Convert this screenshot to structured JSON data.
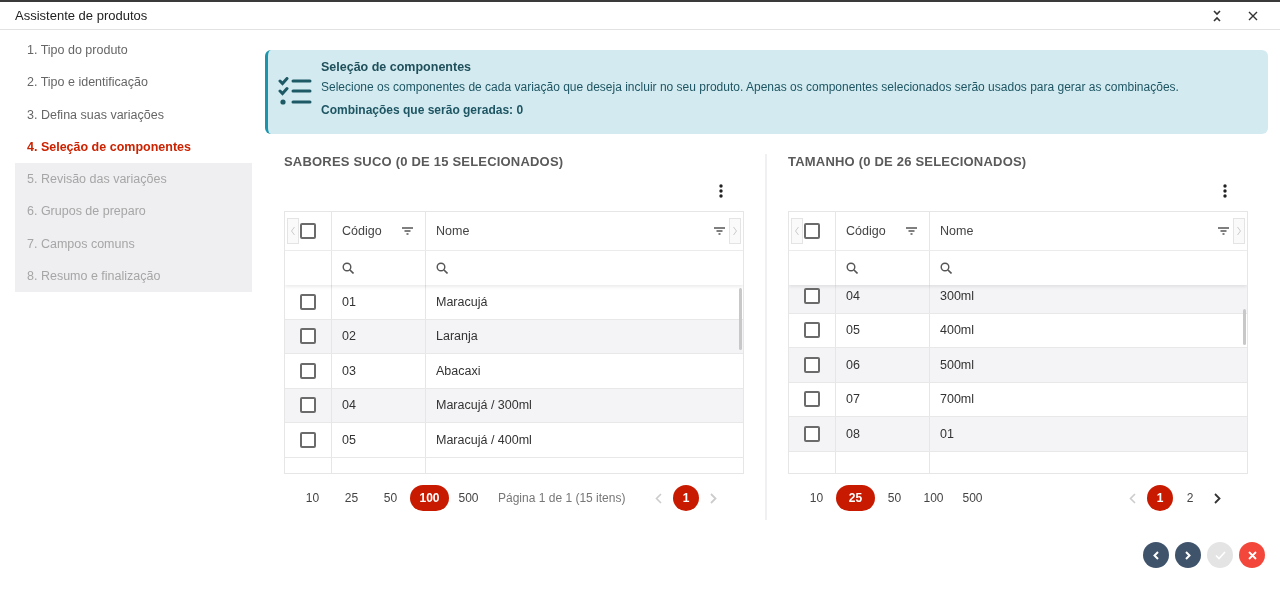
{
  "window": {
    "title": "Assistente de produtos"
  },
  "steps": [
    {
      "label": "1. Tipo do produto",
      "selected": false,
      "disabled": false
    },
    {
      "label": "2. Tipo e identificação",
      "selected": false,
      "disabled": false
    },
    {
      "label": "3. Defina suas variações",
      "selected": false,
      "disabled": false
    },
    {
      "label": "4. Seleção de componentes",
      "selected": true,
      "disabled": false
    },
    {
      "label": "5. Revisão das variações",
      "selected": false,
      "disabled": true
    },
    {
      "label": "6. Grupos de preparo",
      "selected": false,
      "disabled": true
    },
    {
      "label": "7. Campos comuns",
      "selected": false,
      "disabled": true
    },
    {
      "label": "8. Resumo e finalização",
      "selected": false,
      "disabled": true
    }
  ],
  "info": {
    "title": "Seleção de componentes",
    "text": "Selecione os componentes de cada variação que deseja incluir no seu produto. Apenas os componentes selecionados serão usados para gerar as combinações.",
    "combinations": "Combinações que serão geradas: 0"
  },
  "panels": [
    {
      "title": "SABORES SUCO (0 DE 15 SELECIONADOS)",
      "all_checked": false,
      "columns": [
        "Código",
        "Nome"
      ],
      "rows": [
        {
          "code": "01",
          "name": "Maracujá",
          "checked": false
        },
        {
          "code": "02",
          "name": "Laranja",
          "checked": false
        },
        {
          "code": "03",
          "name": "Abacaxi",
          "checked": false
        },
        {
          "code": "04",
          "name": "Maracujá / 300ml",
          "checked": false
        },
        {
          "code": "05",
          "name": "Maracujá / 400ml",
          "checked": false
        }
      ],
      "page_sizes": [
        {
          "label": "10",
          "selected": false
        },
        {
          "label": "25",
          "selected": false
        },
        {
          "label": "50",
          "selected": false
        },
        {
          "label": "100",
          "selected": true
        },
        {
          "label": "500",
          "selected": false
        }
      ],
      "page_info": "Página 1 de 1 (15 itens)",
      "prev_disabled": true,
      "next_disabled": true,
      "pages": [
        {
          "label": "1",
          "selected": true
        }
      ]
    },
    {
      "title": "TAMANHO (0 DE 26 SELECIONADOS)",
      "all_checked": false,
      "columns": [
        "Código",
        "Nome"
      ],
      "rows": [
        {
          "code": "04",
          "name": "300ml",
          "checked": false
        },
        {
          "code": "05",
          "name": "400ml",
          "checked": false
        },
        {
          "code": "06",
          "name": "500ml",
          "checked": false
        },
        {
          "code": "07",
          "name": "700ml",
          "checked": false
        },
        {
          "code": "08",
          "name": "01",
          "checked": false
        }
      ],
      "page_sizes": [
        {
          "label": "10",
          "selected": false
        },
        {
          "label": "25",
          "selected": true
        },
        {
          "label": "50",
          "selected": false
        },
        {
          "label": "100",
          "selected": false
        },
        {
          "label": "500",
          "selected": false
        }
      ],
      "prev_disabled": true,
      "next_disabled": false,
      "pages": [
        {
          "label": "1",
          "selected": true
        },
        {
          "label": "2",
          "selected": false
        }
      ]
    }
  ],
  "actions": [
    {
      "kind": "back",
      "disabled": false
    },
    {
      "kind": "forward",
      "disabled": false
    },
    {
      "kind": "confirm",
      "disabled": true
    },
    {
      "kind": "cancel",
      "disabled": false
    }
  ]
}
